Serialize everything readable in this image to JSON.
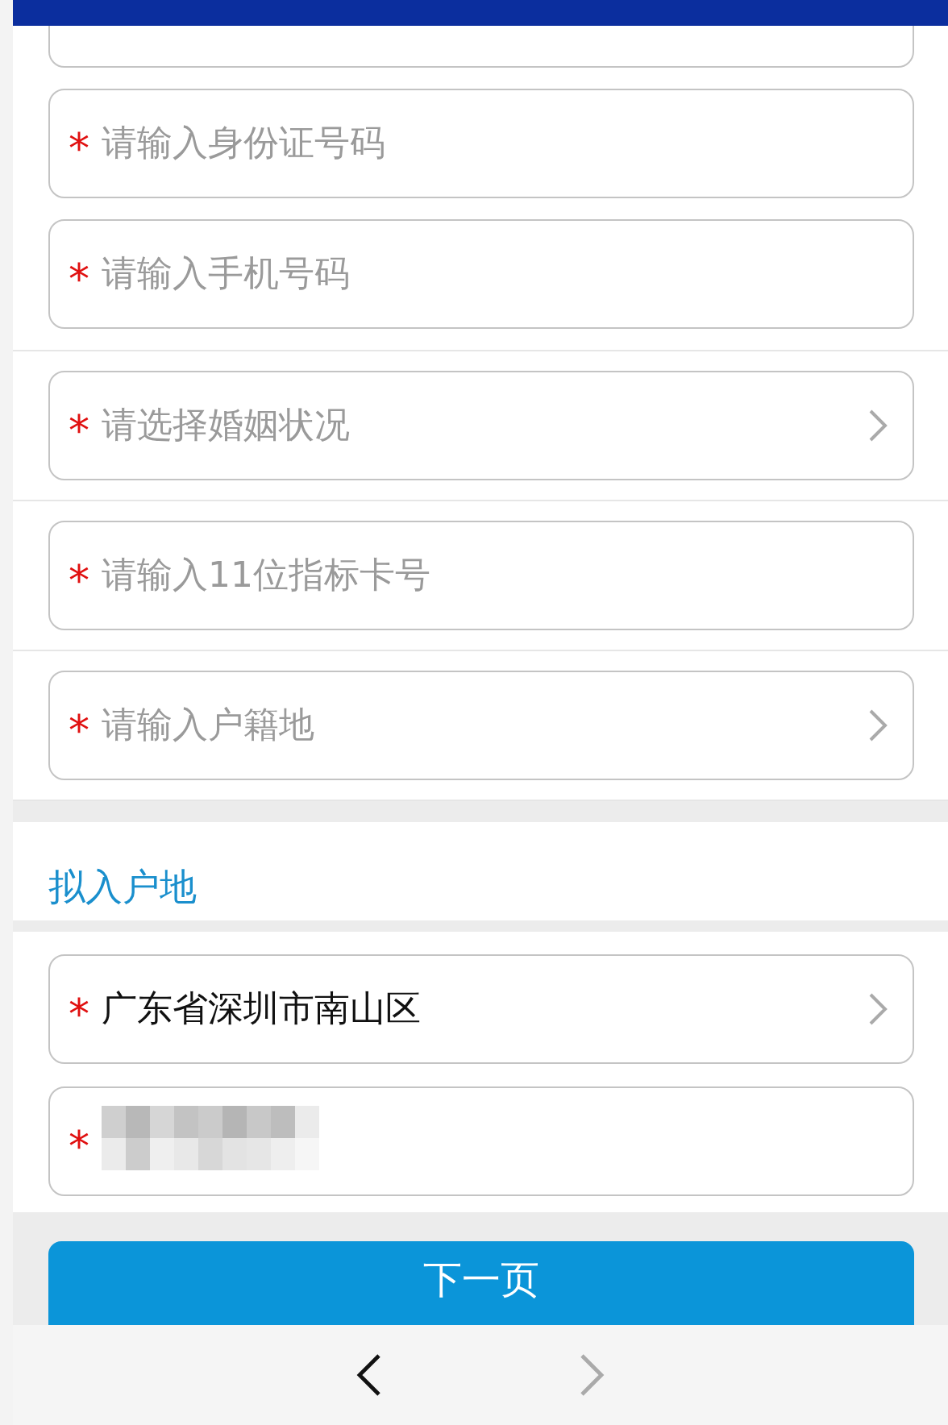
{
  "applicant_fields": [
    {
      "kind": "input"
    },
    {
      "kind": "input",
      "mark": "*",
      "placeholder": "请输入身份证号码"
    },
    {
      "kind": "input",
      "mark": "*",
      "placeholder": "请输入手机号码"
    },
    {
      "kind": "select",
      "mark": "*",
      "placeholder": "请选择婚姻状况"
    },
    {
      "kind": "input",
      "mark": "*",
      "placeholder": "请输入11位指标卡号"
    },
    {
      "kind": "select",
      "mark": "*",
      "placeholder": "请输入户籍地"
    }
  ],
  "destination": {
    "title": "拟入户地",
    "fields": [
      {
        "kind": "select",
        "mark": "*",
        "value": "广东省深圳市南山区"
      },
      {
        "kind": "blurred",
        "mark": "*"
      }
    ]
  },
  "next_button": "下一页"
}
